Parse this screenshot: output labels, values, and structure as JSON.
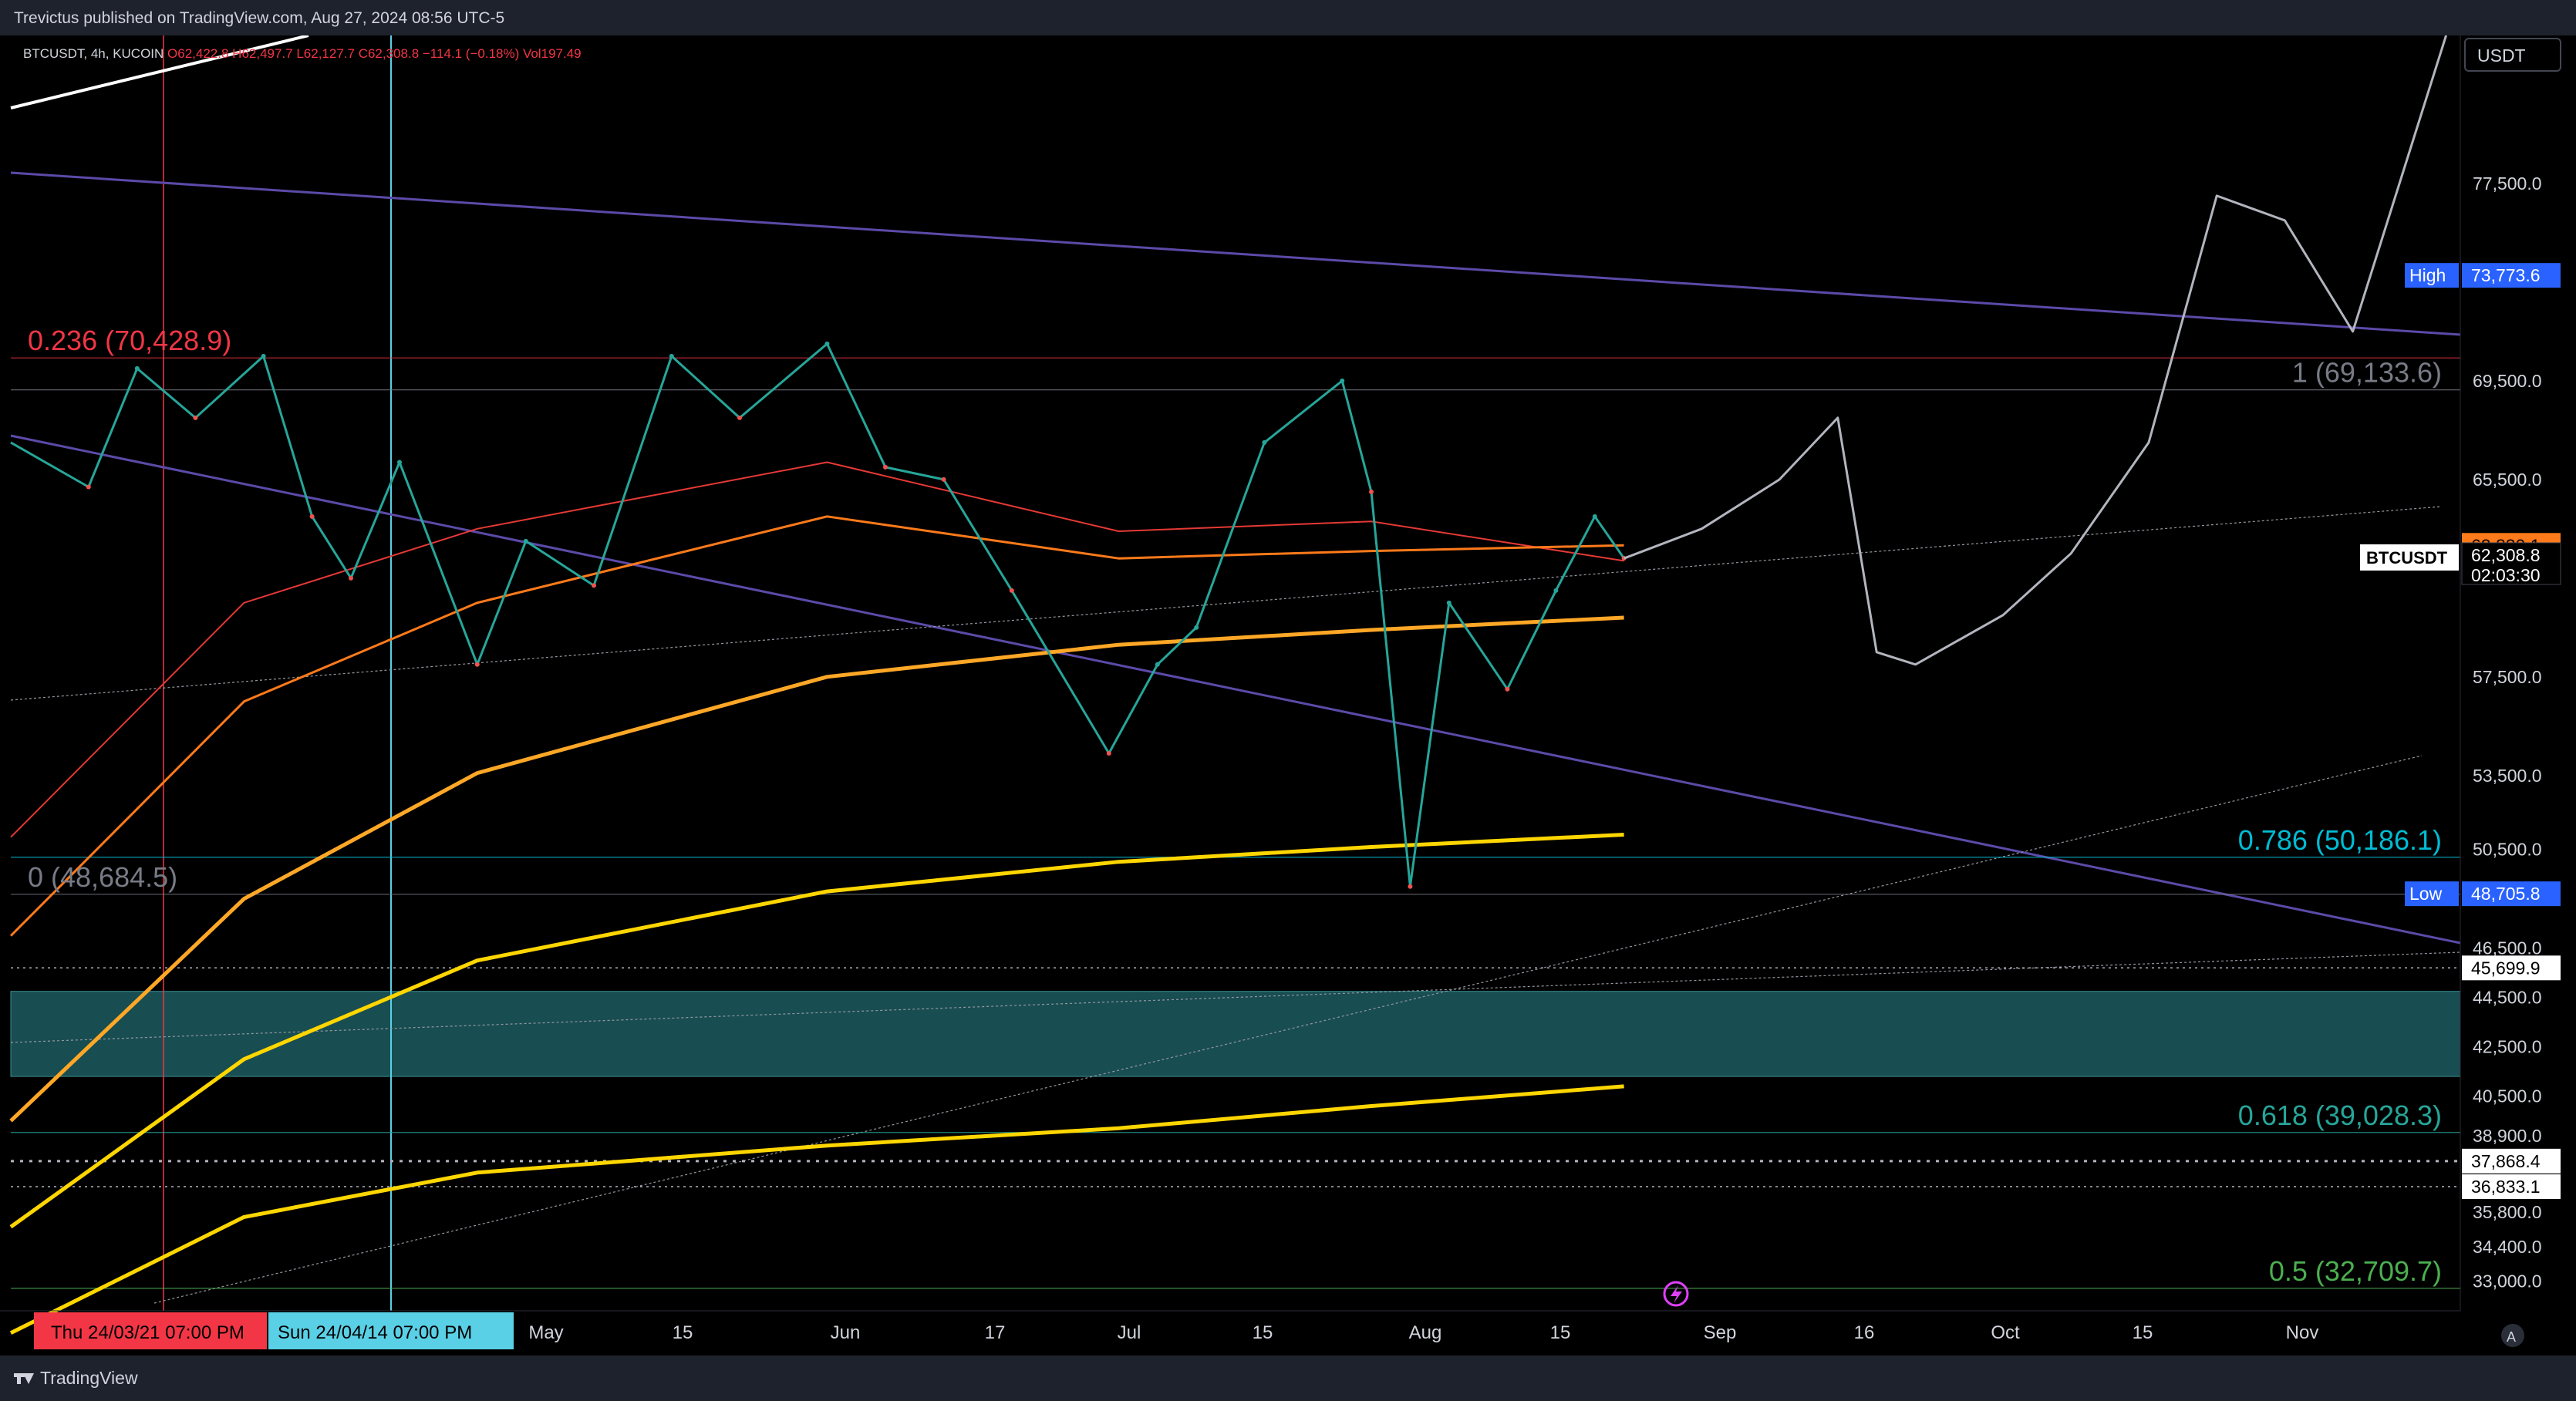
{
  "header": {
    "published": "Trevictus published on TradingView.com, Aug 27, 2024 08:56 UTC-5"
  },
  "legend": {
    "symbol": "BTCUSDT, 4h, KUCOIN",
    "ohlc": "O62,422.8 H62,497.7 L62,127.7 C62,308.8 −114.1 (−0.18%)",
    "volume": "Vol197.49"
  },
  "price_axis": {
    "currency": "USDT",
    "ticks": [
      "77,500.0",
      "69,500.0",
      "65,500.0",
      "57,500.0",
      "53,500.0",
      "50,500.0",
      "46,500.0",
      "44,500.0",
      "42,500.0",
      "40,500.0",
      "38,900.0",
      "35,800.0",
      "34,400.0",
      "33,000.0"
    ],
    "high_label": "High",
    "high_value": "73,773.6",
    "low_label": "Low",
    "low_value": "48,705.8",
    "ma_value": "62,830.1",
    "symbol_tag": "BTCUSDT",
    "last_price": "62,308.8",
    "countdown": "02:03:30",
    "level_a": "45,699.9",
    "level_b": "37,868.4",
    "level_c": "36,833.1"
  },
  "fib": {
    "f0236": "0.236 (70,428.9)",
    "f1": "1 (69,133.6)",
    "f0": "0 (48,684.5)",
    "f0786": "0.786 (50,186.1)",
    "f0618": "0.618 (39,028.3)",
    "f05": "0.5 (32,709.7)"
  },
  "time_axis": {
    "ticks": [
      "May",
      "15",
      "Jun",
      "17",
      "Jul",
      "15",
      "Aug",
      "15",
      "Sep",
      "16",
      "Oct",
      "15",
      "Nov"
    ],
    "marker1": "Thu 24/03/21   07:00 PM",
    "marker2": "Sun 24/04/14   07:00 PM"
  },
  "footer": {
    "brand": "TradingView"
  },
  "colors": {
    "fib_red": "#f23645",
    "fib_gray": "#787b86",
    "fib_cyan": "#00bcd4",
    "fib_teal": "#26a69a",
    "fib_green": "#4caf50",
    "ma_red": "#e53935",
    "ma_orange": "#ff7a1a",
    "ma_amber": "#ffa726",
    "ma_yellow": "#ffd600",
    "channel": "#5c4aa8",
    "zone": "#1c5b5f"
  },
  "chart_data": {
    "type": "line",
    "title": "BTCUSDT, 4h, KUCOIN",
    "ylabel": "USDT",
    "ylim": [
      31800,
      83500
    ],
    "close_price": 62308.8,
    "period_high": 73773.6,
    "period_low": 48705.8,
    "fib_levels": [
      {
        "ratio": 0.236,
        "price": 70428.9
      },
      {
        "ratio": 1,
        "price": 69133.6
      },
      {
        "ratio": 0,
        "price": 48684.5
      },
      {
        "ratio": 0.786,
        "price": 50186.1
      },
      {
        "ratio": 0.618,
        "price": 39028.3
      },
      {
        "ratio": 0.5,
        "price": 32709.7
      }
    ],
    "price_path": {
      "x": [
        "2024-03-14",
        "2024-03-22",
        "2024-03-27",
        "2024-04-02",
        "2024-04-09",
        "2024-04-14",
        "2024-04-18",
        "2024-04-23",
        "2024-05-01",
        "2024-05-06",
        "2024-05-13",
        "2024-05-21",
        "2024-05-28",
        "2024-06-06",
        "2024-06-12",
        "2024-06-18",
        "2024-06-25",
        "2024-07-05",
        "2024-07-10",
        "2024-07-14",
        "2024-07-21",
        "2024-07-29",
        "2024-08-01",
        "2024-08-05",
        "2024-08-09",
        "2024-08-15",
        "2024-08-20",
        "2024-08-24",
        "2024-08-27"
      ],
      "y": [
        67000,
        65200,
        70000,
        68000,
        70500,
        64000,
        61500,
        66200,
        58000,
        63000,
        61200,
        70500,
        68000,
        71000,
        66000,
        65500,
        61000,
        54400,
        58000,
        59500,
        67000,
        69500,
        65000,
        49000,
        60500,
        57000,
        61000,
        64000,
        62308.8
      ]
    },
    "projection": {
      "x": [
        "2024-08-27",
        "2024-09-04",
        "2024-09-12",
        "2024-09-18",
        "2024-09-22",
        "2024-09-26",
        "2024-10-05",
        "2024-10-12",
        "2024-10-20",
        "2024-10-27",
        "2024-11-03",
        "2024-11-10",
        "2024-11-16",
        "2024-11-20"
      ],
      "y": [
        62300,
        63500,
        65500,
        68000,
        58500,
        58000,
        60000,
        62500,
        67000,
        77000,
        76000,
        71500,
        79000,
        84000
      ]
    },
    "moving_averages": [
      {
        "x": [
          "2024-03-14",
          "2024-04-07",
          "2024-05-01",
          "2024-06-06",
          "2024-07-06",
          "2024-08-01",
          "2024-08-27"
        ],
        "y": [
          51000,
          60500,
          63500,
          66200,
          63400,
          63800,
          62200
        ]
      },
      {
        "x": [
          "2024-03-14",
          "2024-04-07",
          "2024-05-01",
          "2024-06-06",
          "2024-07-06",
          "2024-08-01",
          "2024-08-27"
        ],
        "y": [
          47000,
          56500,
          60500,
          64000,
          62300,
          62600,
          62830.1
        ]
      },
      {
        "x": [
          "2024-03-14",
          "2024-04-07",
          "2024-05-01",
          "2024-06-06",
          "2024-07-06",
          "2024-08-01",
          "2024-08-27"
        ],
        "y": [
          39500,
          48500,
          53600,
          57500,
          58800,
          59400,
          59900
        ]
      },
      {
        "x": [
          "2024-03-14",
          "2024-04-07",
          "2024-05-01",
          "2024-06-06",
          "2024-07-06",
          "2024-08-01",
          "2024-08-27"
        ],
        "y": [
          35200,
          42000,
          46000,
          48800,
          50000,
          50600,
          51100
        ]
      },
      {
        "x": [
          "2024-03-14",
          "2024-04-07",
          "2024-05-01",
          "2024-06-06",
          "2024-07-06",
          "2024-08-01",
          "2024-08-27"
        ],
        "y": [
          30900,
          35600,
          37400,
          38500,
          39200,
          40100,
          40900
        ]
      }
    ],
    "zone": {
      "from": 41300,
      "to": 44750
    },
    "grid": false
  }
}
